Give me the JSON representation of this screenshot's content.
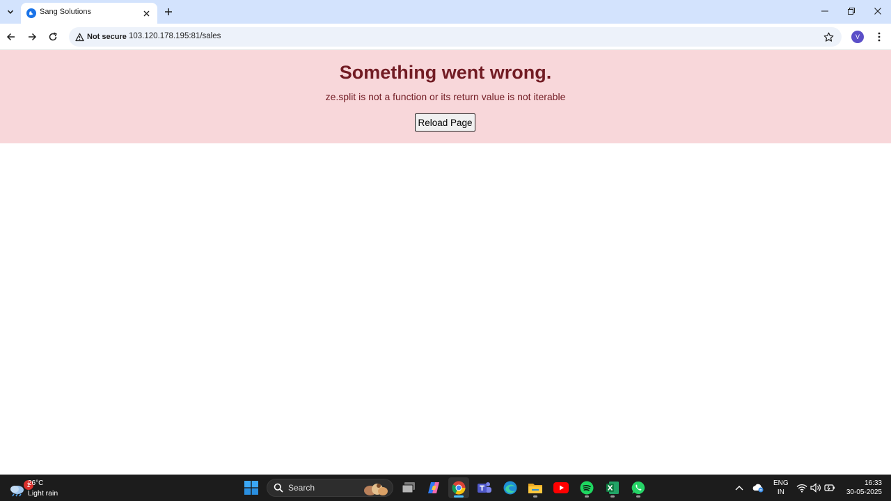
{
  "browser": {
    "tab": {
      "title": "Sang Solutions"
    },
    "address_bar": {
      "security_label": "Not secure",
      "url": "103.120.178.195:81/sales"
    },
    "profile_initial": "V",
    "colors": {
      "tabstrip": "#d3e3fd",
      "omnibox": "#edf2fa",
      "avatar": "#5b4fc8"
    }
  },
  "page": {
    "error": {
      "title": "Something went wrong.",
      "message": "ze.split is not a function or its return value is not iterable",
      "reload_label": "Reload Page"
    },
    "colors": {
      "banner_bg": "#f8d7da",
      "banner_text": "#721c24"
    }
  },
  "taskbar": {
    "weather": {
      "badge": "1",
      "temperature": "26°C",
      "condition": "Light rain"
    },
    "search_placeholder": "Search",
    "pinned_apps": [
      "start-icon",
      "search-icon",
      "task-view-icon",
      "copilot-icon",
      "chrome-icon",
      "teams-icon",
      "edge-icon",
      "file-explorer-icon",
      "youtube-icon",
      "spotify-icon",
      "excel-icon",
      "whatsapp-icon"
    ],
    "language": {
      "line1": "ENG",
      "line2": "IN"
    },
    "clock": {
      "time": "16:33",
      "date": "30-05-2025"
    }
  }
}
